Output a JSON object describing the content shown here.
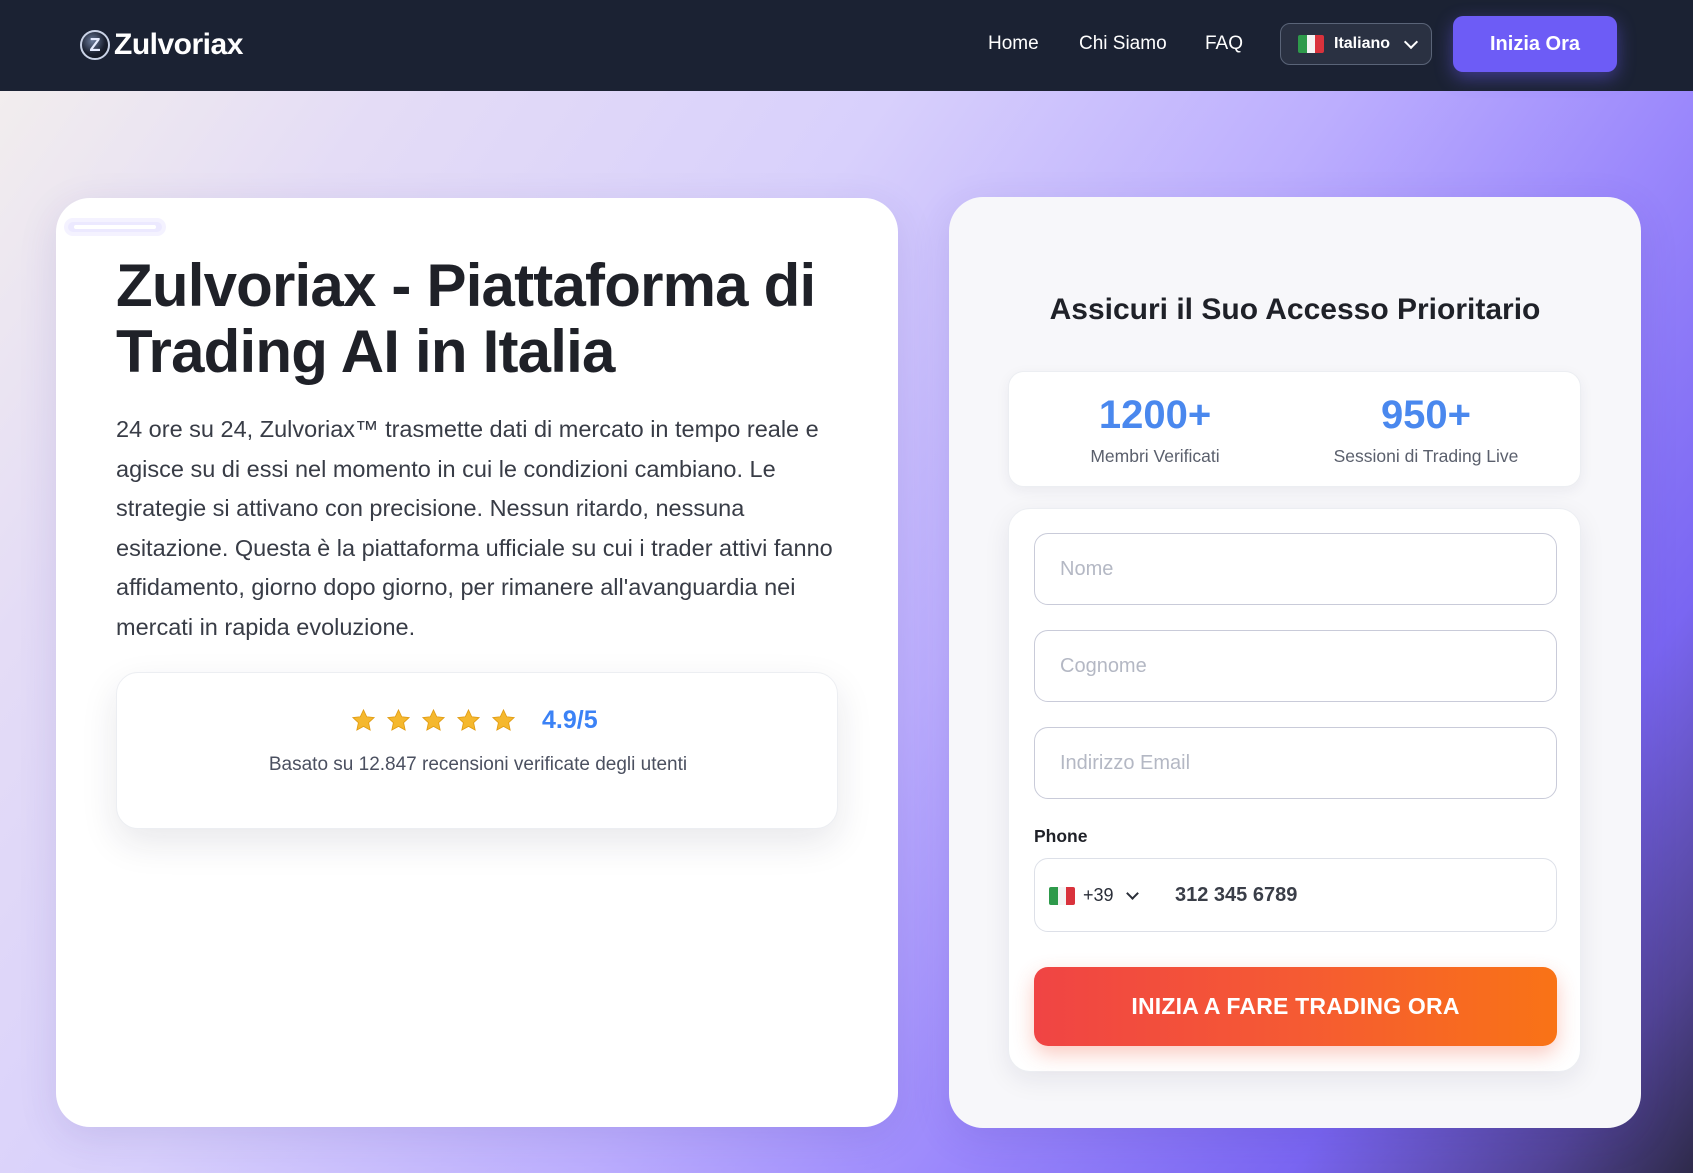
{
  "navbar": {
    "brand_glyph": "Z",
    "brand_name": "Zulvoriax",
    "links": [
      {
        "label": "Home"
      },
      {
        "label": "Chi Siamo"
      },
      {
        "label": "FAQ"
      }
    ],
    "language": {
      "label": "Italiano",
      "flag_icon": "italy-flag-icon"
    },
    "cta_label": "Inizia Ora"
  },
  "hero": {
    "title": "Zulvoriax - Piattaforma di Trading AI in Italia",
    "description": "24 ore su 24, Zulvoriax™ trasmette dati di mercato in tempo reale e agisce su di essi nel momento in cui le condizioni cambiano. Le strategie si attivano con precisione. Nessun ritardo, nessuna esitazione. Questa è la piattaforma ufficiale su cui i trader attivi fanno affidamento, giorno dopo giorno, per rimanere all'avanguardia nei mercati in rapida evoluzione."
  },
  "rating": {
    "stars": 5,
    "star_color": "#f5b82e",
    "value": "4.9/5",
    "note": "Basato su 12.847 recensioni verificate degli utenti"
  },
  "form": {
    "title": "Assicuri il Suo Accesso Prioritario",
    "stats": [
      {
        "value": "1200+",
        "label": "Membri Verificati"
      },
      {
        "value": "950+",
        "label": "Sessioni di Trading Live"
      }
    ],
    "first_name_placeholder": "Nome",
    "last_name_placeholder": "Cognome",
    "email_placeholder": "Indirizzo Email",
    "phone_label": "Phone",
    "phone_prefix": "+39",
    "phone_placeholder": "312 345 6789",
    "submit_label": "INIZIA A FARE TRADING ORA"
  },
  "colors": {
    "navbar_bg": "#1b2233",
    "accent_purple": "#6d5cf6",
    "stat_blue": "#4a88ee",
    "rating_blue": "#3b82f6",
    "submit_gradient": [
      "#f04444",
      "#f97316"
    ]
  }
}
